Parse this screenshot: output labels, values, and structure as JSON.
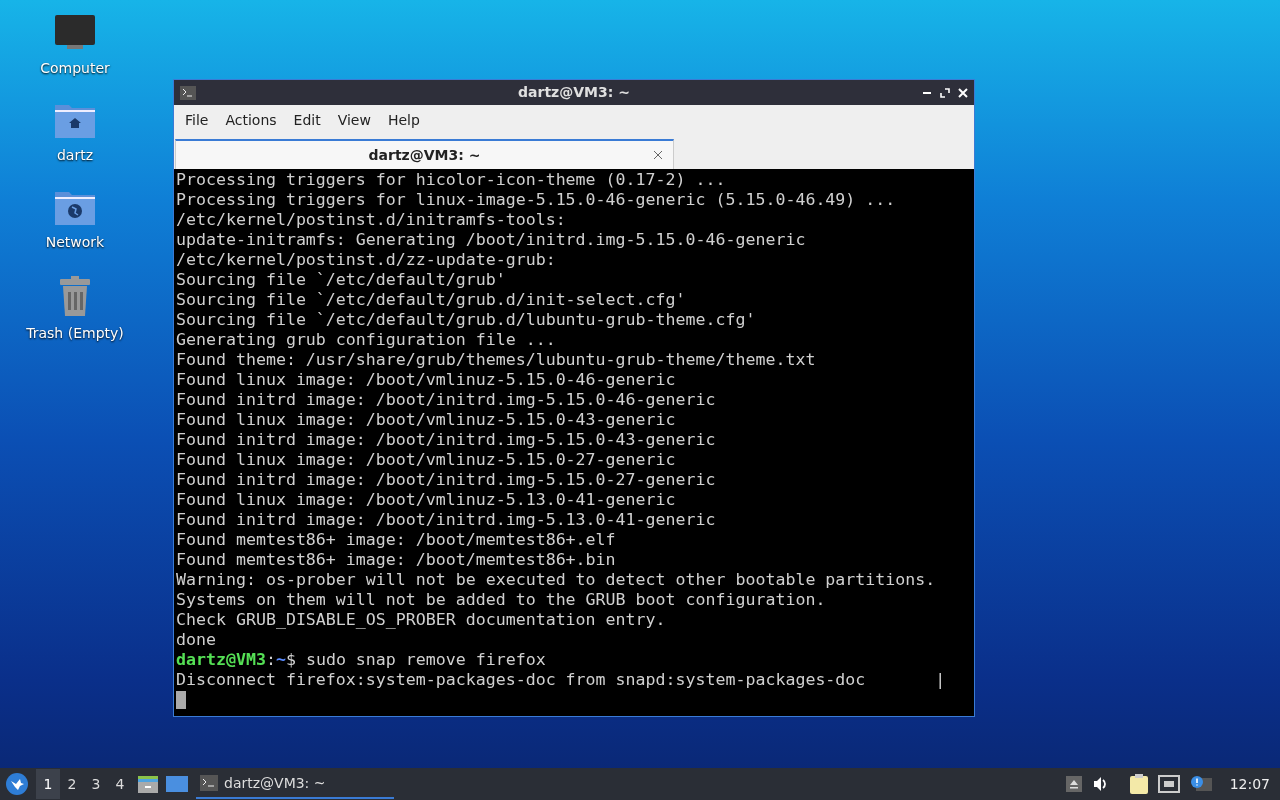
{
  "desktop_icons": [
    {
      "kind": "computer",
      "label": "Computer"
    },
    {
      "kind": "home",
      "label": "dartz"
    },
    {
      "kind": "network",
      "label": "Network"
    },
    {
      "kind": "trash",
      "label": "Trash (Empty)"
    }
  ],
  "window": {
    "title": "dartz@VM3: ~",
    "menu": [
      "File",
      "Actions",
      "Edit",
      "View",
      "Help"
    ],
    "tabs": [
      {
        "label": "dartz@VM3: ~",
        "selected": true
      }
    ],
    "output": [
      "Processing triggers for hicolor-icon-theme (0.17-2) ...",
      "Processing triggers for linux-image-5.15.0-46-generic (5.15.0-46.49) ...",
      "/etc/kernel/postinst.d/initramfs-tools:",
      "update-initramfs: Generating /boot/initrd.img-5.15.0-46-generic",
      "/etc/kernel/postinst.d/zz-update-grub:",
      "Sourcing file `/etc/default/grub'",
      "Sourcing file `/etc/default/grub.d/init-select.cfg'",
      "Sourcing file `/etc/default/grub.d/lubuntu-grub-theme.cfg'",
      "Generating grub configuration file ...",
      "Found theme: /usr/share/grub/themes/lubuntu-grub-theme/theme.txt",
      "Found linux image: /boot/vmlinuz-5.15.0-46-generic",
      "Found initrd image: /boot/initrd.img-5.15.0-46-generic",
      "Found linux image: /boot/vmlinuz-5.15.0-43-generic",
      "Found initrd image: /boot/initrd.img-5.15.0-43-generic",
      "Found linux image: /boot/vmlinuz-5.15.0-27-generic",
      "Found initrd image: /boot/initrd.img-5.15.0-27-generic",
      "Found linux image: /boot/vmlinuz-5.13.0-41-generic",
      "Found initrd image: /boot/initrd.img-5.13.0-41-generic",
      "Found memtest86+ image: /boot/memtest86+.elf",
      "Found memtest86+ image: /boot/memtest86+.bin",
      "Warning: os-prober will not be executed to detect other bootable partitions.",
      "Systems on them will not be added to the GRUB boot configuration.",
      "Check GRUB_DISABLE_OS_PROBER documentation entry.",
      "done"
    ],
    "prompt": {
      "user": "dartz@VM3",
      "separator": ":",
      "path": "~",
      "symbol": "$",
      "command": "sudo snap remove firefox"
    },
    "progress_line": "Disconnect firefox:system-packages-doc from snapd:system-packages-doc",
    "spinner": "|"
  },
  "taskbar": {
    "workspaces": [
      {
        "label": "1",
        "selected": true
      },
      {
        "label": "2",
        "selected": false
      },
      {
        "label": "3",
        "selected": false
      },
      {
        "label": "4",
        "selected": false
      }
    ],
    "tasks": [
      {
        "label": "dartz@VM3: ~",
        "selected": true
      }
    ],
    "clock": "12:07"
  }
}
